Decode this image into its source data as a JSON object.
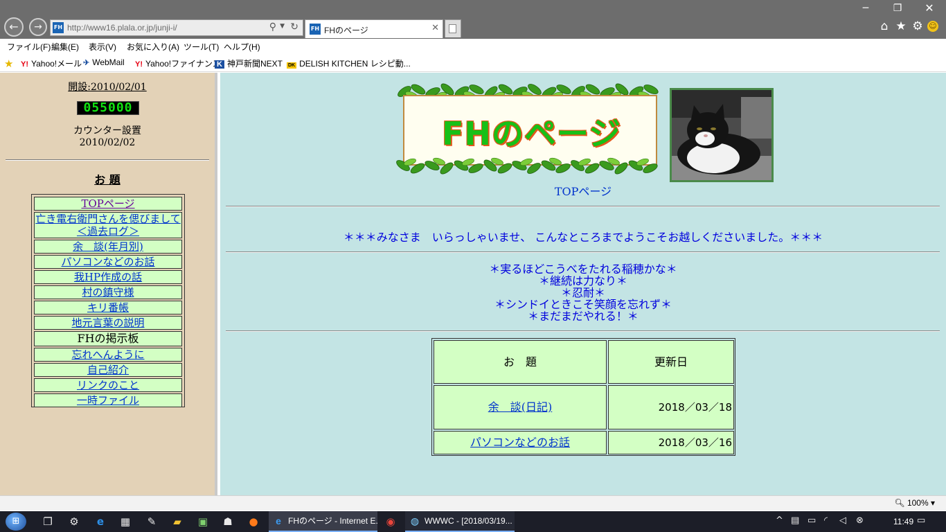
{
  "browser": {
    "url": "http://www16.plala.or.jp/junji-i/",
    "tab_title": "FHのページ",
    "favicon_text": "FH",
    "zoom": "100%"
  },
  "menu": [
    "ファイル(F)",
    "編集(E)",
    "表示(V)",
    "お気に入り(A)",
    "ツール(T)",
    "ヘルプ(H)"
  ],
  "favorites": [
    "Yahoo!メール",
    "WebMail",
    "Yahoo!ファイナンス",
    "神戸新聞NEXT",
    "DELISH KITCHEN レシピ動..."
  ],
  "favorite_icons": [
    "yahoo-icon",
    "webmail-icon",
    "yahoo-icon",
    "kobe-shimbun-icon",
    "delish-kitchen-icon"
  ],
  "sidebar": {
    "open_date": "開設:2010/02/01",
    "counter": "055000",
    "counter_label": "カウンター設置",
    "counter_date": "2010/02/02",
    "topics_heading": "お 題",
    "nav": [
      {
        "label": "TOPページ"
      },
      {
        "label": "亡き電右衛門さんを偲びまして",
        "label2": "＜過去ログ＞"
      },
      {
        "label": "余　談(年月別)"
      },
      {
        "label": "パソコンなどのお話"
      },
      {
        "label": "我HP作成の話"
      },
      {
        "label": "村の鎮守様"
      },
      {
        "label": "キリ番帳"
      },
      {
        "label": "地元言葉の説明"
      },
      {
        "label": "FHの掲示板"
      },
      {
        "label": "忘れへんように"
      },
      {
        "label": "自己紹介"
      },
      {
        "label": "リンクのこと"
      },
      {
        "label": "一時ファイル"
      }
    ]
  },
  "main": {
    "banner_title": "FHのページ",
    "top_link": "TOPページ",
    "welcome": "＊＊＊みなさま　いらっしゃいませ、 こんなところまでようこそお越しくださいました。＊＊＊",
    "mottos": [
      "＊実るほどこうべをたれる稲穂かな＊",
      "＊継続は力なり＊",
      "＊忍耐＊",
      "＊シンドイときこそ笑顔を忘れず＊",
      "＊まだまだやれる！＊"
    ],
    "updates": {
      "headers": [
        "お　題",
        "更新日"
      ],
      "rows": [
        {
          "title": "余　談(日記)",
          "date": "2018／03／18"
        },
        {
          "title": "パソコンなどのお話",
          "date": "2018／03／16"
        }
      ]
    }
  },
  "taskbar": {
    "tasks": [
      {
        "label": "FHのページ - Internet E...",
        "icon": "ie-icon"
      },
      {
        "label": "WWWC - [2018/03/19...",
        "icon": "wwwc-icon"
      }
    ],
    "time": "11:49"
  },
  "colors": {
    "sidebar_bg": "#e3d2b7",
    "content_bg": "#c3e4e4",
    "cell_bg": "#d3ffc4",
    "link": "#0033cc",
    "text_blue": "#0000dd"
  }
}
